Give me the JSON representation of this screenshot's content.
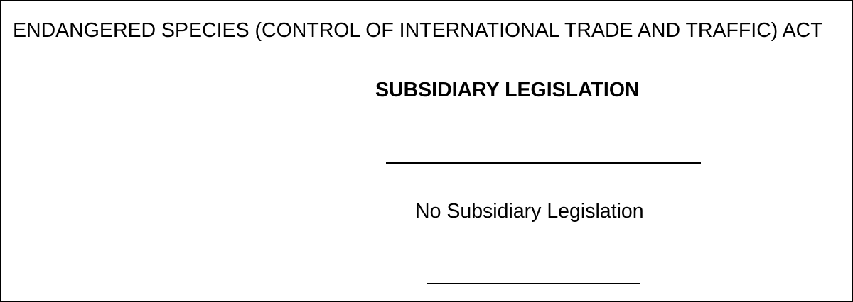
{
  "document": {
    "act_title": "ENDANGERED SPECIES (CONTROL OF INTERNATIONAL TRADE AND TRAFFIC) ACT",
    "heading": "SUBSIDIARY LEGISLATION",
    "note": "No Subsidiary Legislation"
  }
}
